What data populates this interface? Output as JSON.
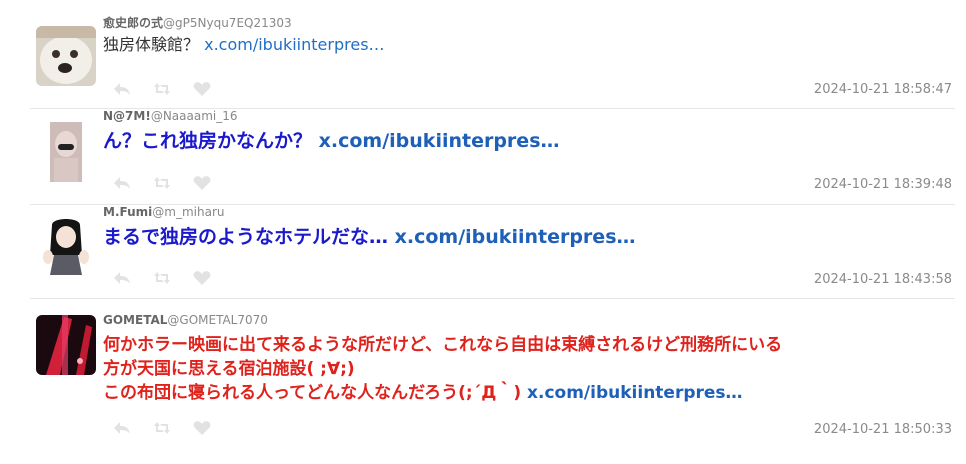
{
  "tweets": [
    {
      "name": "愈史郎の式",
      "handle": "@gP5Nyqu7EQ21303",
      "text": "独房体験館？",
      "link": "x.com/ibukiinterpres…",
      "time": "2024-10-21 18:58:47"
    },
    {
      "name": "N@7M!",
      "handle": "@Naaaami_16",
      "text": "ん？これ独房かなんか？",
      "link": "x.com/ibukiinterpres…",
      "time": "2024-10-21 18:39:48"
    },
    {
      "name": "M.Fumi",
      "handle": "@m_miharu",
      "text": "まるで独房のようなホテルだな…",
      "link": "x.com/ibukiinterpres…",
      "time": "2024-10-21 18:43:58"
    },
    {
      "name": "GOMETAL",
      "handle": "@GOMETAL7070",
      "text_line1": "何かホラー映画に出て来るような所だけど、これなら自由は束縛されるけど刑務所にいる",
      "text_line2": "方が天国に思える宿泊施設( ;∀;)",
      "text_line3": "この布団に寝られる人ってどんな人なんだろう(;´Д｀)",
      "link": "x.com/ibukiinterpres…",
      "time": "2024-10-21 18:50:33"
    }
  ],
  "icons": [
    "reply-icon",
    "retweet-icon",
    "like-icon"
  ],
  "colors": {
    "link": "#1f6fc5",
    "emphasis_blue": "#1a1acc",
    "emphasis_red": "#e0221c",
    "meta": "#8a8a8a",
    "divider": "#e6e6e6"
  }
}
